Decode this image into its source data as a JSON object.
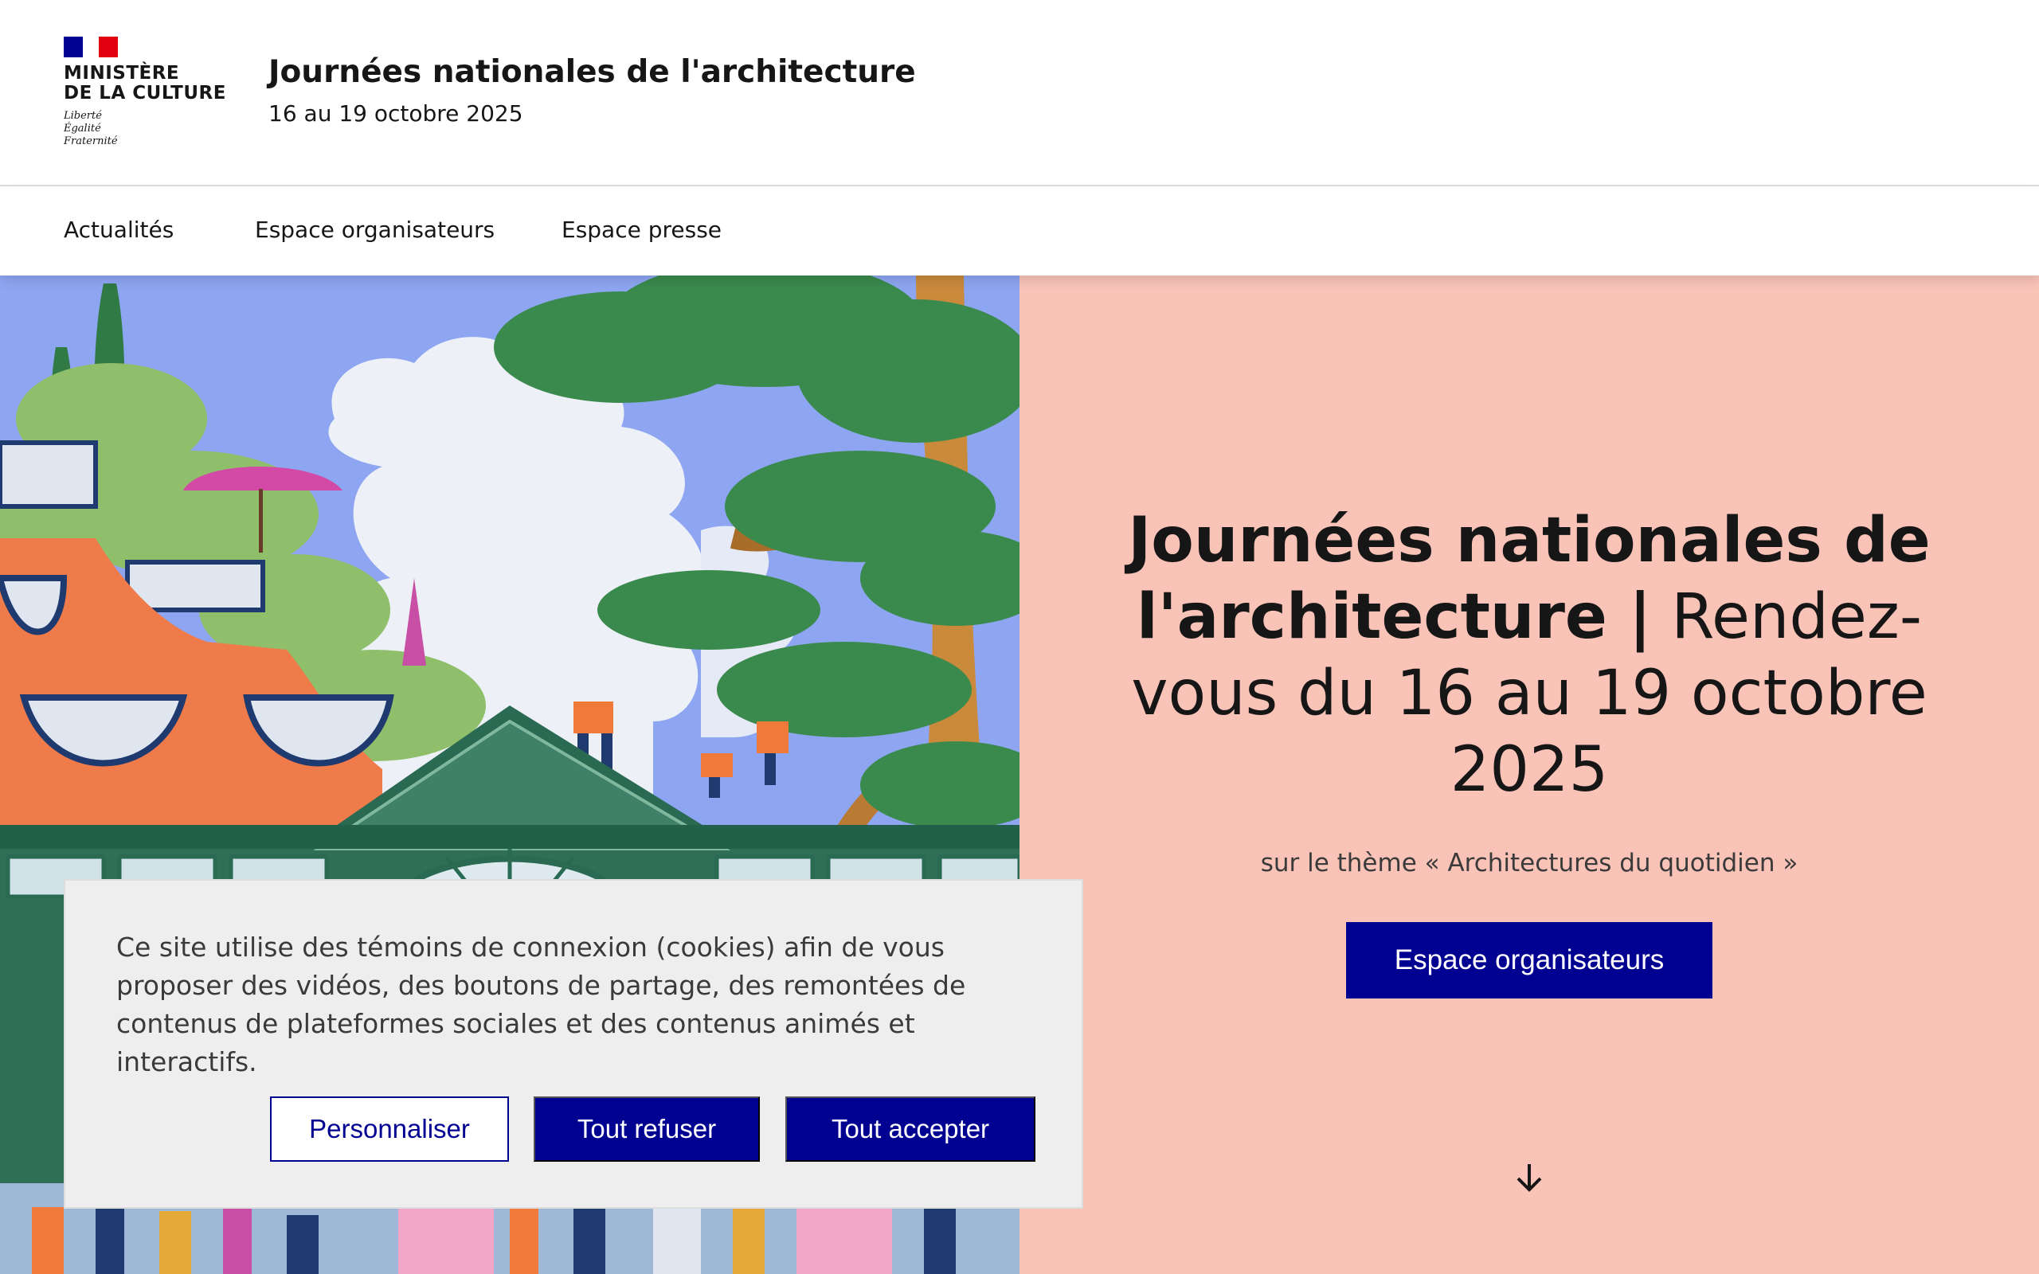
{
  "header": {
    "ministry_line1": "MINISTÈRE",
    "ministry_line2": "DE LA CULTURE",
    "motto_1": "Liberté",
    "motto_2": "Égalité",
    "motto_3": "Fraternité",
    "site_title": "Journées nationales de l'architecture",
    "site_subtitle": "16 au 19 octobre 2025"
  },
  "nav": {
    "items": [
      {
        "label": "Actualités"
      },
      {
        "label": "Espace organisateurs"
      },
      {
        "label": "Espace presse"
      }
    ]
  },
  "hero": {
    "title_bold": "Journées nationales de l'architecture |",
    "title_light": " Rendez-vous du 16 au 19 octobre 2025",
    "theme": "sur le thème « Architectures du quotidien »",
    "cta_label": "Espace organisateurs",
    "background_color": "#f9c3b8"
  },
  "cookie_banner": {
    "text": "Ce site utilise des témoins de connexion (cookies) afin de vous proposer des vidéos, des boutons de partage, des remontées de contenus de plateformes sociales et des contenus animés et interactifs.",
    "customize_label": "Personnaliser",
    "refuse_label": "Tout refuser",
    "accept_label": "Tout accepter"
  },
  "colors": {
    "primary": "#000091",
    "hero_pink": "#f9c3b8",
    "flag_red": "#e1000f"
  }
}
